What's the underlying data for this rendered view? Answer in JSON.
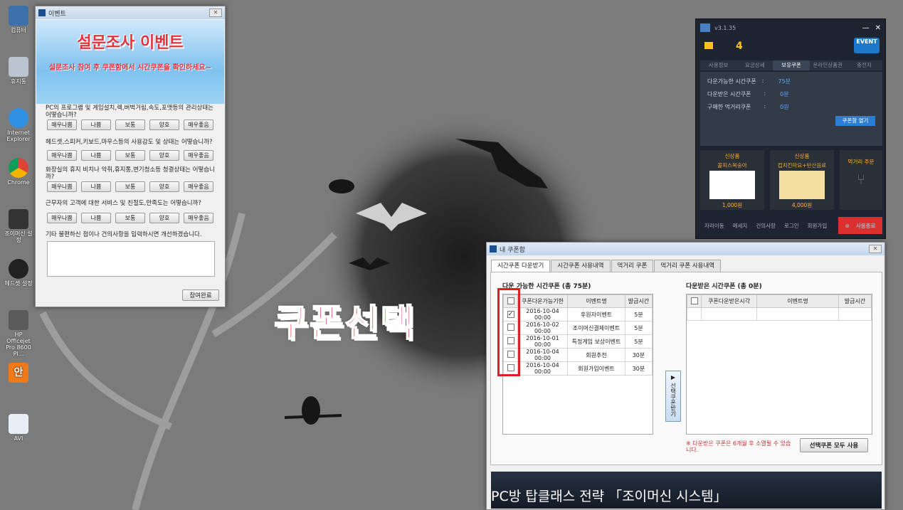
{
  "desktop": {
    "icons": [
      {
        "label": "컴퓨터"
      },
      {
        "label": "휴지통"
      },
      {
        "label": "Internet Explorer"
      },
      {
        "label": "Chrome"
      },
      {
        "label": "조이머신 설정"
      },
      {
        "label": "헤드셋 설정"
      },
      {
        "label": "HP Officejet Pro 8600 Pl..."
      },
      {
        "label": "안"
      },
      {
        "label": "AVI"
      }
    ]
  },
  "survey": {
    "title": "이벤트",
    "banner_title": "설문조사 이벤트",
    "banner_sub": "설문조사 참여 후 쿠폰함에서 시간쿠폰을 확인하세요~",
    "questions": [
      "PC의 프로그램 및 게임설치,렉,버벅거림,속도,포맷등의 관리상태는 어떻습니까?",
      "헤드셋,스피커,키보드,마우스등의 사용감도 및 상태는 어떻습니까?",
      "화장실의 휴지 비치나 악취,휴지통,변기청소등 청결상태는 어떻습니까?",
      "근무자의 고객에 대한 서비스 및 친절도,만족도는 어떻습니까?"
    ],
    "options": [
      "매우나쁨",
      "나쁨",
      "보통",
      "양호",
      "매우좋음"
    ],
    "free_text_label": "기타 불편하신 점이나 건의사항을 입력하시면 개선하겠습니다.",
    "submit_label": "참여완료"
  },
  "pcbang": {
    "version": "v3.1.35",
    "seat": "4",
    "event_badge": "EVENT",
    "tabs": [
      "사용정보",
      "요금상세",
      "보유쿠폰",
      "온라인상품권",
      "충전지"
    ],
    "active_tab": 2,
    "rows": [
      {
        "label": "다운가능한 시간쿠폰",
        "value": "75분"
      },
      {
        "label": "다운받은 시간쿠폰",
        "value": "0분"
      },
      {
        "label": "구매한 먹거리쿠폰",
        "value": "0원"
      }
    ],
    "open_coupon_label": "쿠폰함 열기",
    "products": [
      {
        "tag": "신상품",
        "name": "콜피스복숭아",
        "price": "1,000원"
      },
      {
        "tag": "신상품",
        "name": "컵치킨마요+탄산음료",
        "price": "4,000원"
      },
      {
        "tag": "",
        "name": "먹거리 주문",
        "price": ""
      }
    ],
    "bottom": [
      "자리이동",
      "메세지",
      "건의사항",
      "로그인",
      "회원가입"
    ],
    "end_label": "사용종료"
  },
  "coupon": {
    "title": "내 쿠폰함",
    "tabs": [
      "시간쿠폰 다운받기",
      "시간쿠폰 사용내역",
      "먹거리 쿠폰",
      "먹거리 쿠폰 사용내역"
    ],
    "left_title": "다운 가능한 시간쿠폰 (총 75분)",
    "left_headers": [
      "쿠폰다운가능기한",
      "이벤트명",
      "발급시간"
    ],
    "left_rows": [
      {
        "date": "2016-10-04 00:00",
        "event": "후원자이벤트",
        "time": "5분",
        "checked": true
      },
      {
        "date": "2016-10-02 00:00",
        "event": "조이머신결제이벤트",
        "time": "5분",
        "checked": false
      },
      {
        "date": "2016-10-01 00:00",
        "event": "특정게임 보상이벤트",
        "time": "5분",
        "checked": false
      },
      {
        "date": "2016-10-04 00:00",
        "event": "회원추천",
        "time": "30분",
        "checked": false
      },
      {
        "date": "2016-10-04 00:00",
        "event": "회원가입이벤트",
        "time": "30분",
        "checked": false
      }
    ],
    "move_label": "선택쿠폰받기",
    "right_title": "다운받은 시간쿠폰 (총 0분)",
    "right_headers": [
      "쿠폰다운받은시각",
      "이벤트명",
      "발급시간"
    ],
    "note": "※ 다운받은 쿠폰은 6개월 후 소멸될 수 있습니다.",
    "use_all_label": "선택쿠폰 모두 사용",
    "banner_text": "PC방 탑클래스 전략 「조이머신 시스템」"
  },
  "overlay": {
    "caption": "쿠폰선택"
  }
}
